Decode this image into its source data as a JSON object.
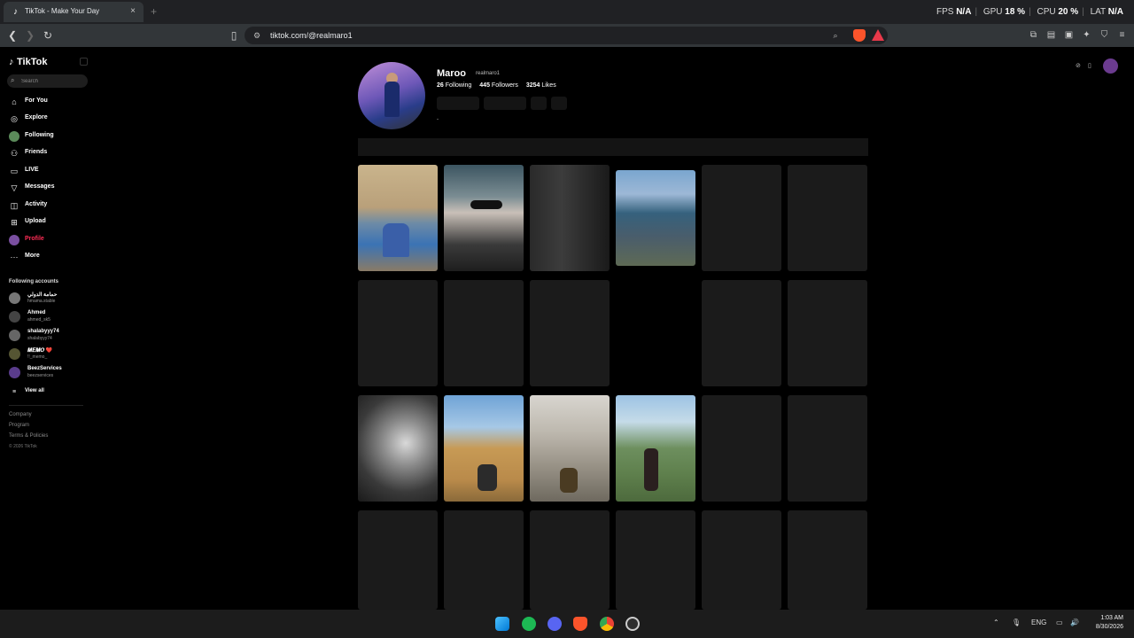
{
  "browser": {
    "tab_title": "TikTok - Make Your Day",
    "tab_favicon": "tiktok-icon",
    "close_glyph": "×",
    "new_tab_glyph": "+",
    "url": "tiktok.com/@realmaro1",
    "perf": {
      "fps_label": "FPS",
      "fps_value": "N/A",
      "gpu_label": "GPU",
      "gpu_value": "18 %",
      "cpu_label": "CPU",
      "cpu_value": "20 %",
      "lat_label": "LAT",
      "lat_value": "N/A"
    }
  },
  "sidebar": {
    "logo": "TikTok",
    "search_placeholder": "Search",
    "nav": [
      {
        "label": "For You",
        "icon": "home-icon"
      },
      {
        "label": "Explore",
        "icon": "compass-icon"
      },
      {
        "label": "Following",
        "icon": "following-avatar"
      },
      {
        "label": "Friends",
        "icon": "friends-icon"
      },
      {
        "label": "LIVE",
        "icon": "live-icon"
      },
      {
        "label": "Messages",
        "icon": "messages-icon"
      },
      {
        "label": "Activity",
        "icon": "activity-icon"
      },
      {
        "label": "Upload",
        "icon": "upload-icon"
      },
      {
        "label": "Profile",
        "icon": "profile-avatar"
      },
      {
        "label": "More",
        "icon": "more-icon"
      }
    ],
    "following_title": "Following accounts",
    "accounts": [
      {
        "name": "حمامة الدولي",
        "handle": "hmama.stable"
      },
      {
        "name": "Ahmed",
        "handle": "ahmed_sk5"
      },
      {
        "name": "shalabyyy74",
        "handle": "shalabyyy74"
      },
      {
        "name": "𝑴𝑬𝑴𝑶 ❤️",
        "handle": "!!_memo_"
      },
      {
        "name": "BeezServices",
        "handle": "beezservices"
      }
    ],
    "view_all": "View all",
    "footer": [
      "Company",
      "Program",
      "Terms & Policies"
    ],
    "copyright": "© 2026 TikTok"
  },
  "profile": {
    "display_name": "Maroo",
    "username": "realmaro1",
    "following_count": "26",
    "following_label": "Following",
    "followers_count": "445",
    "followers_label": "Followers",
    "likes_count": "3254",
    "likes_label": "Likes",
    "bio": "-"
  },
  "taskbar": {
    "language": "ENG",
    "time": "1:03 AM",
    "date": "8/30/2026"
  },
  "colors": {
    "accent": "#fe2c55",
    "bg": "#000000",
    "tile_placeholder": "#1b1b1b"
  }
}
